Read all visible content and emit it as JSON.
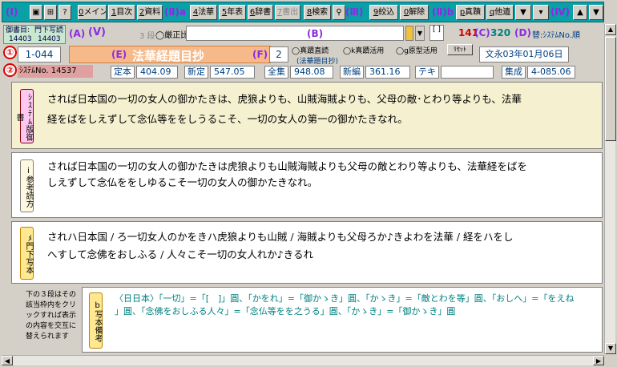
{
  "toolbar": {
    "c1": "(Ⅰ)",
    "c2": "(Ⅱ)",
    "c2_suffix": "a",
    "c3": "(Ⅲ)",
    "c3b": "(Ⅱ)",
    "c3b_suffix": "b",
    "c4": "(Ⅳ)",
    "btn_main": "メイン",
    "btn_main_key": "0",
    "btn_toc": "目次",
    "btn_toc_key": "1",
    "btn_src": "資料",
    "btn_src_key": "2",
    "btn_lotus": "法華",
    "btn_lotus_key": "4",
    "btn_year": "年表",
    "btn_year_key": "5",
    "btn_dict": "辞書",
    "btn_dict_key": "6",
    "btn_write": "書出",
    "btn_write_key": "7",
    "btn_search": "検索",
    "btn_search_key": "8",
    "btn_narrow": "絞込",
    "btn_narrow_key": "9",
    "btn_release": "解除",
    "btn_release_key": "0",
    "btn_genuine": "真蹟",
    "btn_genuine_key": "p",
    "btn_other": "他遺",
    "btn_other_key": "q"
  },
  "row2": {
    "gosho_label": "御書目:",
    "gosho_num": "14403",
    "gosho_sub_label": "門下写読",
    "gosho_sub_num": "14403",
    "marker_a": "(A)",
    "marker_v": "(Ⅴ)",
    "san_dan": "3 段",
    "compare_label": "厳正比較",
    "marker_b": "(B)",
    "count_red": "141",
    "marker_c": "(C)",
    "count_teal": "320",
    "marker_d": "(D)",
    "sort_label": "替:ｼｽﾃﾑNo.順"
  },
  "row3": {
    "num1": "①",
    "id_value": "1-044",
    "marker_e": "(E)",
    "title": "法華経題目抄",
    "marker_f": "(F)",
    "page_sel": "2",
    "radio1": "真蹟直読",
    "radio2": "k真蹟活用",
    "radio3": "g原型活用",
    "note": "(法華題目抄)",
    "reset": "ﾘｾｯﾄ",
    "date": "文永03年01月06日"
  },
  "row4": {
    "num2": "②",
    "sys_label": "ｼｽﾃﾑNo.",
    "sys_value": "14537",
    "teihon_label": "定本",
    "teihon_value": "404.09",
    "shintei_label": "新定",
    "shintei_value": "547.05",
    "zenshu_label": "全集",
    "zenshu_value": "948.08",
    "shinpen_label": "新編",
    "shinpen_value": "361.16",
    "text_label": "テキ",
    "text_value": "",
    "shusei_label": "集成",
    "shusei_value": "4-085.06"
  },
  "panels": {
    "system_label": "ｼｽﾃﾑ版御書",
    "system_line1": "されば日本国の一切の女人の御かたきは、虎狼よりも、山賊海賊よりも、父母の敵･とわり等よりも、法華",
    "system_line2": "経をばをしえずして念仏等ををしうるこそ、一切の女人の第一の御かたきなれ。",
    "ref_label": "i参考読方",
    "ref_line1": "されば日本国の一切の女人の御かたきは虎狼よりも山賊海賊よりも父母の敵とわり等よりも、法華経をばを",
    "ref_line2": "しえずして念仏ををしゆるこそ一切の女人の御かたきなれ。",
    "copy_label": "ﾒ門下写本",
    "copy_line1": "されハ日本国 / ろ一切女人のかをきハ虎狼よりも山賊 / 海賊よりも父母ろか♪きよわを法華 / 経をハをし",
    "copy_line2": "へすして念佛をおしふる / 人々こそ一切の女人れか♪きるれ",
    "note_text": "下の３段はその該当枠内をクリックすれば表示の内容を交互に替えられます",
    "bikou_label": "b写本備考",
    "bikou_line1": "〈日日本〉「一切」=「[　]」圓、「かをれ」=「御かゝき」圓、「かゝき」=「敵とわを等」圓、「おしへ」=「をえね",
    "bikou_line2": "」圓、「念佛をおしふる人々」=「念仏等をを之うる」圓、「かゝき」=「御かゝき」圓"
  },
  "colors": {
    "toolbar_bg": "#0aa0a8",
    "title_bg": "#f6b98a",
    "panel_system_bg": "#f5f0d0",
    "red_count": "#d00000",
    "teal_count": "#008080"
  }
}
